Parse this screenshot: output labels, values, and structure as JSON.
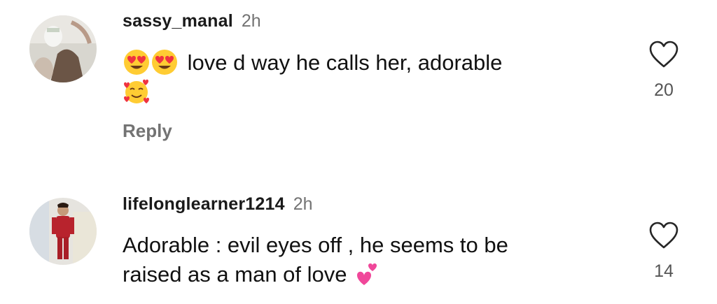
{
  "comments": [
    {
      "username": "sassy_manal",
      "time": "2h",
      "text": "love d way he calls her, adorable",
      "emojis_before": [
        "smiling-face-with-heart-eyes",
        "smiling-face-with-heart-eyes"
      ],
      "emoji_after": "smiling-face-with-hearts",
      "reply_label": "Reply",
      "likes": "20"
    },
    {
      "username": "lifelonglearner1214",
      "time": "2h",
      "text_line1": "Adorable : evil eyes off , he seems to be",
      "text_line2": "raised as a man of love",
      "emoji_after": "two-hearts",
      "likes": "14"
    }
  ],
  "colors": {
    "text": "#111111",
    "muted": "#737373",
    "background": "#ffffff"
  },
  "icons": {
    "like": "heart-outline-icon"
  }
}
